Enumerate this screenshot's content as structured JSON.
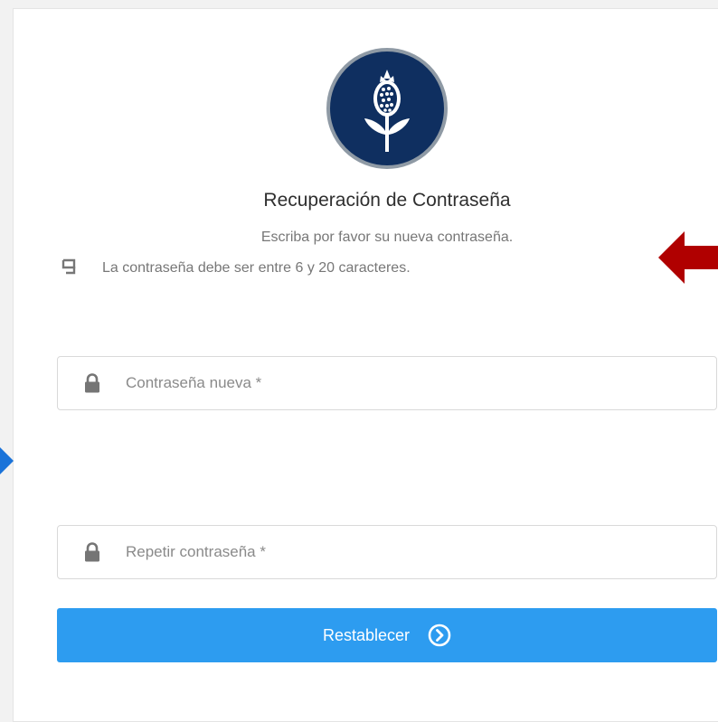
{
  "header": {
    "title": "Recuperación de Contraseña",
    "subtitle": "Escriba por favor su nueva contraseña.",
    "rule_text": "La contraseña debe ser entre 6 y 20 caracteres."
  },
  "form": {
    "new_password": {
      "value": "",
      "placeholder": "Contraseña nueva *"
    },
    "repeat_password": {
      "value": "",
      "placeholder": "Repetir contraseña *"
    },
    "submit_label": "Restablecer"
  },
  "colors": {
    "logo_background": "#0f2f60",
    "logo_border": "#8f9aa5",
    "button": "#2d9cf0",
    "annotation_arrow_red": "#b00000",
    "annotation_arrow_blue": "#1a73d9"
  },
  "icons": {
    "logo": "pomegranate-logo-icon",
    "rule": "info-rule-icon",
    "field": "lock-icon",
    "submit": "chevron-circle-right-icon"
  }
}
